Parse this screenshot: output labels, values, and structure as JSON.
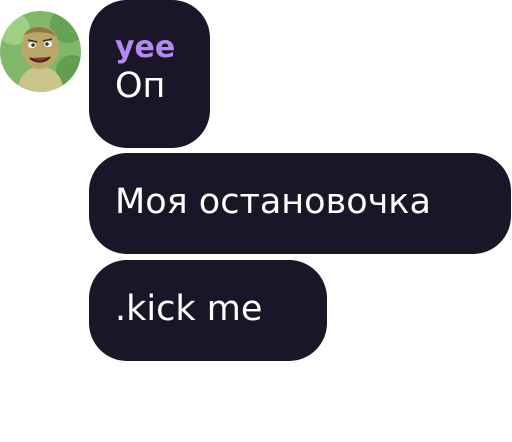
{
  "message_group": {
    "author": {
      "username": "yee",
      "username_color": "#b489f0",
      "avatar": "cartoon-character-avatar"
    },
    "bubble_color": "#1a1628",
    "messages": [
      {
        "text": "Оп"
      },
      {
        "text": "Моя остановочка"
      },
      {
        "text": ".kick me"
      }
    ]
  }
}
